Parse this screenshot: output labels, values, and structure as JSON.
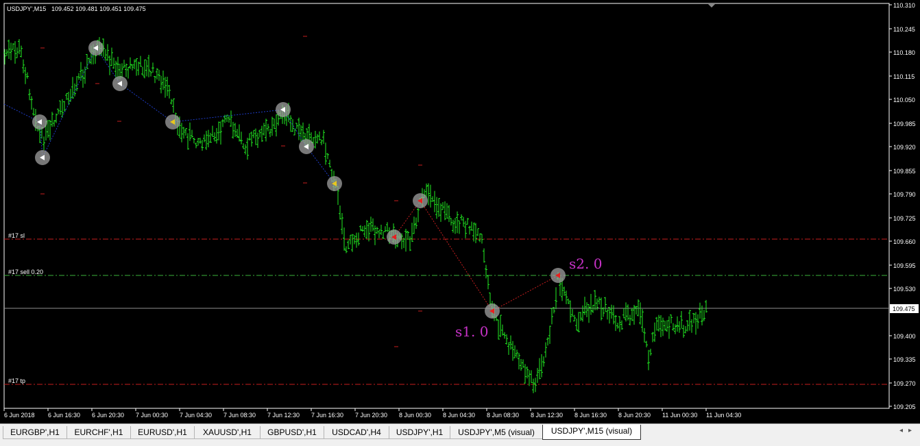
{
  "window": {
    "symbol_label": "USDJPY',M15",
    "ohlc": "109.452 109.481 109.451 109.475",
    "current_price": "109.475"
  },
  "price_axis": {
    "ticks": [
      "110.310",
      "110.245",
      "110.180",
      "110.115",
      "110.050",
      "109.985",
      "109.920",
      "109.855",
      "109.790",
      "109.725",
      "109.660",
      "109.595",
      "109.530",
      "109.400",
      "109.335",
      "109.270",
      "109.205"
    ]
  },
  "time_axis": {
    "ticks": [
      "6 Jun 2018",
      "6 Jun 16:30",
      "6 Jun 20:30",
      "7 Jun 00:30",
      "7 Jun 04:30",
      "7 Jun 08:30",
      "7 Jun 12:30",
      "7 Jun 16:30",
      "7 Jun 20:30",
      "8 Jun 00:30",
      "8 Jun 04:30",
      "8 Jun 08:30",
      "8 Jun 12:30",
      "8 Jun 16:30",
      "8 Jun 20:30",
      "11 Jun 00:30",
      "11 Jun 04:30"
    ]
  },
  "order_lines": {
    "sl": {
      "label": "#17 sl",
      "price": 109.665,
      "color": "#c81e1e"
    },
    "entry": {
      "label": "#17 sell 0.20",
      "price": 109.565,
      "color": "#3cb43c"
    },
    "tp": {
      "label": "#17 tp",
      "price": 109.265,
      "color": "#c81e1e"
    }
  },
  "annotations": {
    "s1": "s1. 0",
    "s2": "s2. 0",
    "color": "#c832c8"
  },
  "colors": {
    "background": "#000000",
    "candles": "#22ee22",
    "axis": "#ffffff",
    "past_path": "#1e3cc8",
    "recent_path": "#c81e1e"
  },
  "tabs": [
    {
      "label": "EURGBP',H1"
    },
    {
      "label": "EURCHF',H1"
    },
    {
      "label": "EURUSD',H1"
    },
    {
      "label": "XAUUSD',H1"
    },
    {
      "label": "GBPUSD',H1"
    },
    {
      "label": "USDCAD',H4"
    },
    {
      "label": "USDJPY',H1"
    },
    {
      "label": "USDJPY',M5 (visual)"
    },
    {
      "label": "USDJPY',M15 (visual)",
      "active": true
    }
  ]
}
